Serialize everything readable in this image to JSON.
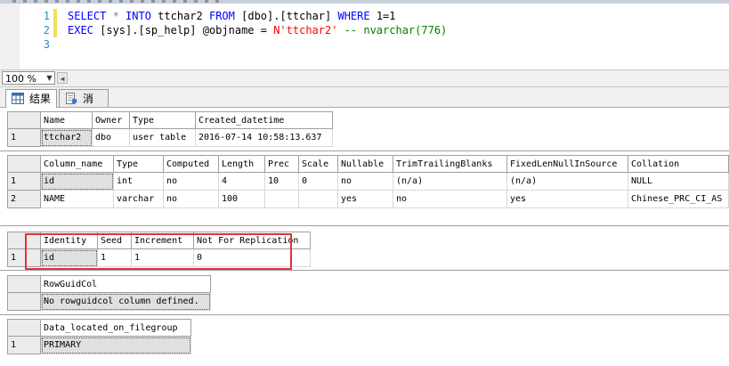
{
  "editor": {
    "line_numbers": [
      "1",
      "2",
      "3"
    ],
    "line1": {
      "kw_select": "SELECT",
      "star": " * ",
      "kw_into": "INTO",
      "t1": " ttchar2 ",
      "kw_from": "FROM",
      "t2": " [dbo].[ttchar] ",
      "kw_where": "WHERE",
      "t3": " 1=1"
    },
    "line2": {
      "kw_exec": "EXEC",
      "t1": " [sys].[sp_help] @objname = ",
      "str": "N'ttchar2'",
      "cm": " -- nvarchar(776)"
    }
  },
  "zoom": {
    "value": "100 %"
  },
  "tabs": {
    "results": "结果",
    "messages": "消息"
  },
  "grid1": {
    "headers": [
      "Name",
      "Owner",
      "Type",
      "Created_datetime"
    ],
    "rows": [
      [
        "1",
        "ttchar2",
        "dbo",
        "user table",
        "2016-07-14 10:58:13.637"
      ]
    ]
  },
  "grid2": {
    "headers": [
      "Column_name",
      "Type",
      "Computed",
      "Length",
      "Prec",
      "Scale",
      "Nullable",
      "TrimTrailingBlanks",
      "FixedLenNullInSource",
      "Collation"
    ],
    "rows": [
      [
        "1",
        "id",
        "int",
        "no",
        "4",
        "10",
        "0",
        "no",
        "(n/a)",
        "(n/a)",
        "NULL"
      ],
      [
        "2",
        "NAME",
        "varchar",
        "no",
        "100",
        "",
        "",
        "yes",
        "no",
        "yes",
        "Chinese_PRC_CI_AS"
      ]
    ]
  },
  "grid3": {
    "headers": [
      "Identity",
      "Seed",
      "Increment",
      "Not For Replication"
    ],
    "rows": [
      [
        "1",
        "id",
        "1",
        "1",
        "0"
      ]
    ]
  },
  "grid4": {
    "headers": [
      "RowGuidCol"
    ],
    "rows": [
      [
        "",
        "No rowguidcol column defined."
      ]
    ]
  },
  "grid5": {
    "headers": [
      "Data_located_on_filegroup"
    ],
    "rows": [
      [
        "1",
        "PRIMARY"
      ]
    ]
  }
}
